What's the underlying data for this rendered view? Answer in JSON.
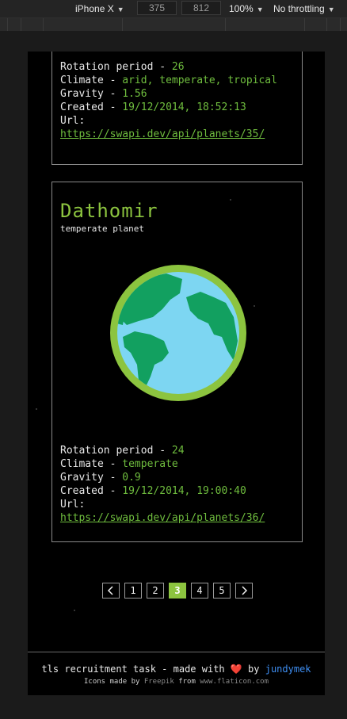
{
  "devtools": {
    "device": "iPhone X",
    "width": "375",
    "height": "812",
    "zoom": "100%",
    "throttling": "No throttling"
  },
  "planets": [
    {
      "name": "",
      "subtitle": "",
      "rotation_label": "Rotation period - ",
      "rotation": "26",
      "climate_label": "Climate - ",
      "climate": "arid, temperate, tropical",
      "gravity_label": "Gravity - ",
      "gravity": "1.56",
      "created_label": "Created - ",
      "created": "19/12/2014, 18:52:13",
      "url_label": "Url:",
      "url": "https://swapi.dev/api/planets/35/"
    },
    {
      "name": "Dathomir",
      "subtitle": "temperate planet",
      "rotation_label": "Rotation period - ",
      "rotation": "24",
      "climate_label": "Climate - ",
      "climate": "temperate",
      "gravity_label": "Gravity - ",
      "gravity": "0.9",
      "created_label": "Created - ",
      "created": "19/12/2014, 19:00:40",
      "url_label": "Url:",
      "url": "https://swapi.dev/api/planets/36/"
    }
  ],
  "pagination": {
    "prev_icon": "chevron-left-icon",
    "next_icon": "chevron-right-icon",
    "pages": [
      "1",
      "2",
      "3",
      "4",
      "5"
    ],
    "current": "3"
  },
  "colors": {
    "accent": "#8cc43f",
    "value": "#6fbd3e",
    "link_blue": "#3e8ef2",
    "globe_ring": "#8cc43f",
    "ocean": "#7dd6f2",
    "land": "#12a060"
  },
  "footer": {
    "text_before": "tls recruitment task - made with ",
    "heart": "❤️",
    "text_by": " by ",
    "author": "jundymek",
    "icons_before": "Icons made by ",
    "icons_author": "Freepik",
    "icons_from": " from ",
    "icons_site": "www.flaticon.com"
  }
}
